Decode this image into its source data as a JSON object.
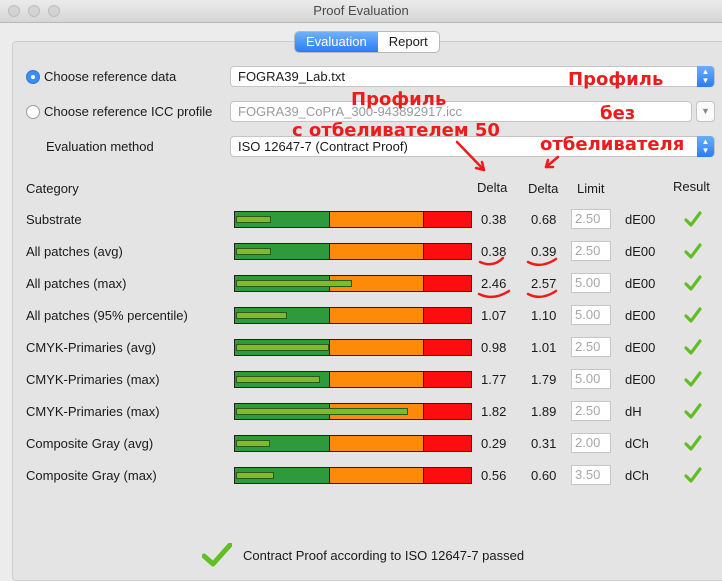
{
  "window": {
    "title": "Proof Evaluation"
  },
  "tabs": [
    {
      "label": "Evaluation",
      "selected": true
    },
    {
      "label": "Report",
      "selected": false
    }
  ],
  "reference": {
    "data_label": "Choose reference data",
    "data_value": "FOGRA39_Lab.txt",
    "icc_label": "Choose reference ICC profile",
    "icc_value": "FOGRA39_CoPrA_300-943892917.icc",
    "method_label": "Evaluation method",
    "method_value": "ISO 12647-7 (Contract Proof)"
  },
  "annotations": {
    "left_line1": "Профиль",
    "left_line2": "с отбеливателем 50",
    "right_line1": "Профиль",
    "right_line2": "без",
    "right_line3": "отбеливателя"
  },
  "headers": {
    "category": "Category",
    "delta1": "Delta",
    "delta2": "Delta",
    "limit": "Limit",
    "result": "Result"
  },
  "rows": [
    {
      "category": "Substrate",
      "delta1": "0.38",
      "delta2": "0.68",
      "limit": "2.50",
      "unit": "dE00",
      "fill": 0.15
    },
    {
      "category": "All patches (avg)",
      "delta1": "0.38",
      "delta2": "0.39",
      "limit": "2.50",
      "unit": "dE00",
      "fill": 0.15
    },
    {
      "category": "All patches (max)",
      "delta1": "2.46",
      "delta2": "2.57",
      "limit": "5.00",
      "unit": "dE00",
      "fill": 0.492
    },
    {
      "category": "All patches (95% percentile)",
      "delta1": "1.07",
      "delta2": "1.10",
      "limit": "5.00",
      "unit": "dE00",
      "fill": 0.214
    },
    {
      "category": "CMYK-Primaries (avg)",
      "delta1": "0.98",
      "delta2": "1.01",
      "limit": "2.50",
      "unit": "dE00",
      "fill": 0.392
    },
    {
      "category": "CMYK-Primaries (max)",
      "delta1": "1.77",
      "delta2": "1.79",
      "limit": "5.00",
      "unit": "dE00",
      "fill": 0.354
    },
    {
      "category": "CMYK-Primaries (max)",
      "delta1": "1.82",
      "delta2": "1.89",
      "limit": "2.50",
      "unit": "dH",
      "fill": 0.728
    },
    {
      "category": "Composite Gray (avg)",
      "delta1": "0.29",
      "delta2": "0.31",
      "limit": "2.00",
      "unit": "dCh",
      "fill": 0.145
    },
    {
      "category": "Composite Gray (max)",
      "delta1": "0.56",
      "delta2": "0.60",
      "limit": "3.50",
      "unit": "dCh",
      "fill": 0.16
    }
  ],
  "footer": {
    "status": "Contract Proof according to ISO 12647-7 passed"
  },
  "colors": {
    "green": "#2e9a3c",
    "orange": "#fe8a09",
    "red": "#fb0d10",
    "check": "#5fbf23",
    "annotation": "#ec1c1c"
  }
}
